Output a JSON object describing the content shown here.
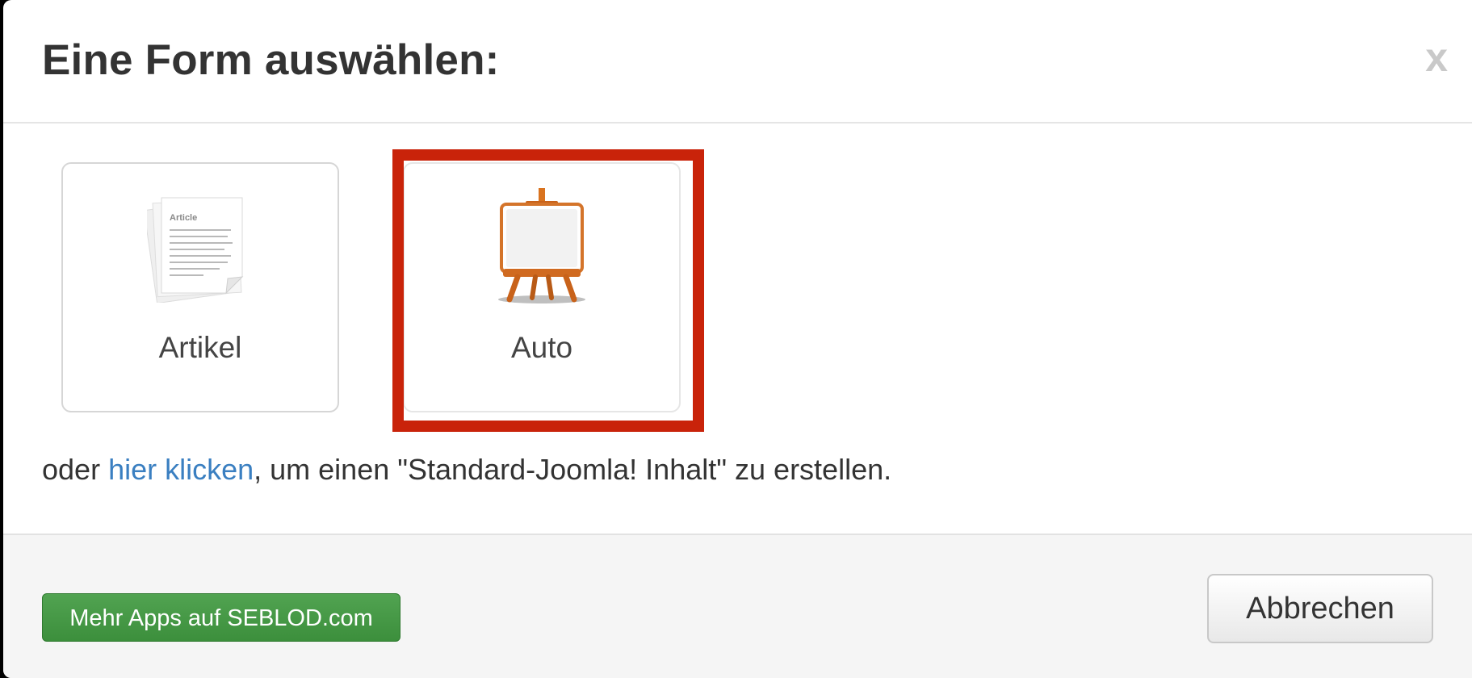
{
  "dialog": {
    "title": "Eine Form auswählen:",
    "close_label": "x"
  },
  "forms": [
    {
      "label": "Artikel",
      "icon": "article-document-icon",
      "icon_text": "Article"
    },
    {
      "label": "Auto",
      "icon": "easel-icon"
    }
  ],
  "highlight": {
    "color": "#c9230a"
  },
  "alternative": {
    "prefix": "oder ",
    "link_label": "hier klicken",
    "suffix": ", um einen \"Standard-Joomla! Inhalt\" zu erstellen."
  },
  "footer": {
    "more_apps_label": "Mehr Apps auf SEBLOD.com",
    "cancel_label": "Abbrechen"
  },
  "colors": {
    "link": "#3a7fc1",
    "green_button": "#51a351",
    "highlight": "#c9230a"
  }
}
